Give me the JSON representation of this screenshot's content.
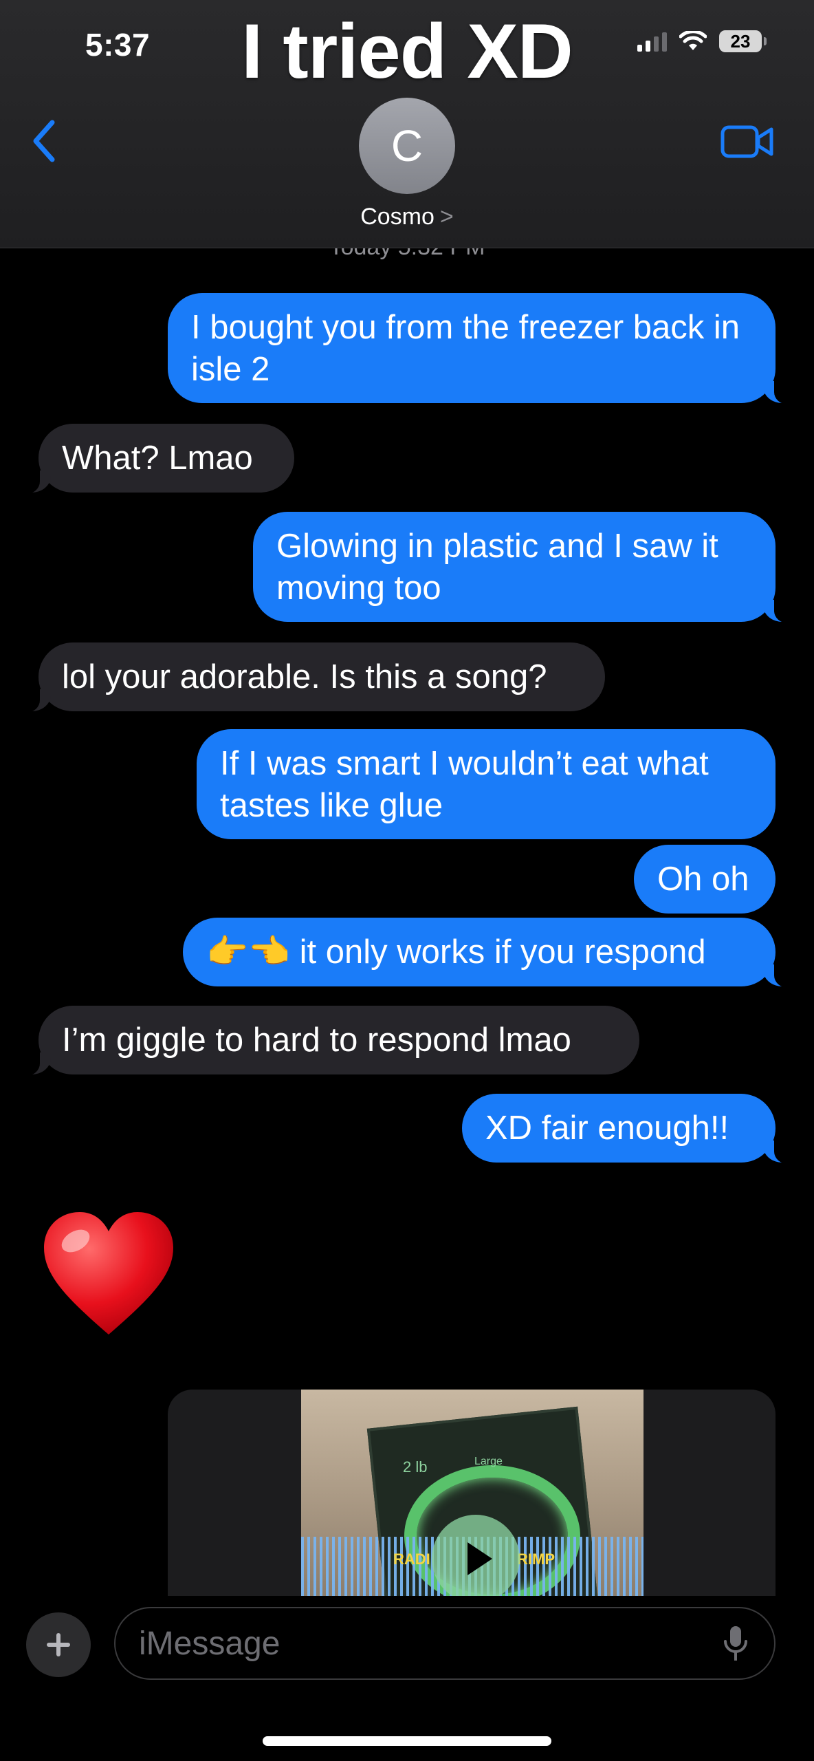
{
  "status_bar": {
    "time": "5:37",
    "battery": "23",
    "signal_bars": 2
  },
  "overlay_caption": "I tried XD",
  "header": {
    "avatar_initial": "C",
    "contact_name": "Cosmo",
    "name_chevron": ">"
  },
  "date_stamp": "Today 5:32 PM",
  "messages": [
    {
      "from": "me",
      "text": "I bought you from the freezer back in isle 2"
    },
    {
      "from": "them",
      "text": "What? Lmao"
    },
    {
      "from": "me",
      "text": "Glowing in plastic and I saw it moving too"
    },
    {
      "from": "them",
      "text": "lol your adorable. Is this a song?"
    },
    {
      "from": "me",
      "text": "If I was smart I wouldn’t eat what tastes like glue"
    },
    {
      "from": "me",
      "text": "Oh oh"
    },
    {
      "from": "me",
      "text": "👉👈 it only works if you respond"
    },
    {
      "from": "them",
      "text": "I’m giggle to hard to respond lmao"
    },
    {
      "from": "me",
      "text": "XD fair enough!!"
    }
  ],
  "reaction_emoji": "heart",
  "video_attachment": {
    "thumb_text_1": "2 lb",
    "thumb_text_2": "Large",
    "thumb_text_3": "RADI",
    "thumb_text_4": "RIMP"
  },
  "composer": {
    "placeholder": "iMessage"
  },
  "colors": {
    "sent_bubble": "#1a7cf9",
    "received_bubble": "#26252a",
    "accent": "#1a7cf9"
  }
}
